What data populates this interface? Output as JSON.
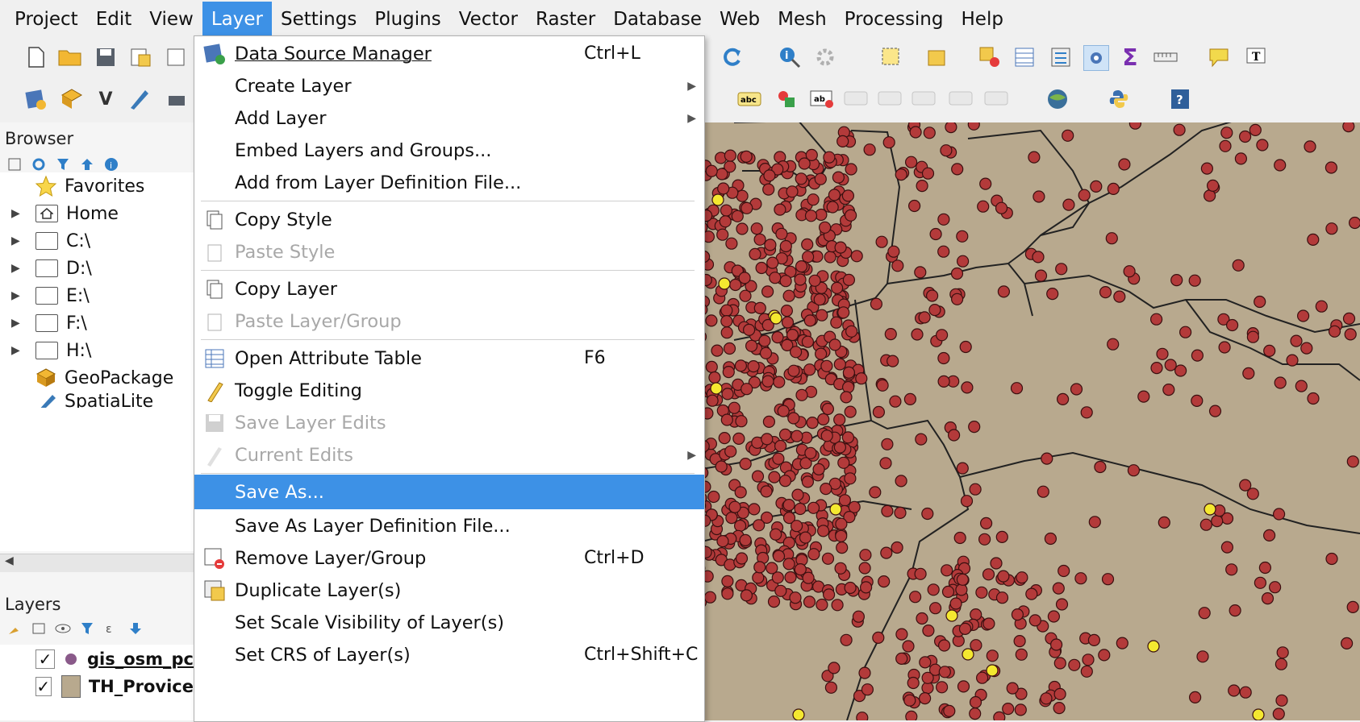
{
  "menubar": {
    "items": [
      "Project",
      "Edit",
      "View",
      "Layer",
      "Settings",
      "Plugins",
      "Vector",
      "Raster",
      "Database",
      "Web",
      "Mesh",
      "Processing",
      "Help"
    ]
  },
  "browser": {
    "title": "Browser",
    "items": [
      {
        "label": "Favorites",
        "icon": "star-icon"
      },
      {
        "label": "Home",
        "icon": "home-icon"
      },
      {
        "label": "C:\\",
        "icon": "folder-icon"
      },
      {
        "label": "D:\\",
        "icon": "folder-icon"
      },
      {
        "label": "E:\\",
        "icon": "folder-icon"
      },
      {
        "label": "F:\\",
        "icon": "folder-icon"
      },
      {
        "label": "H:\\",
        "icon": "folder-icon"
      },
      {
        "label": "GeoPackage",
        "icon": "geopackage-icon"
      },
      {
        "label": "SpatiaLite",
        "icon": "spatialite-icon"
      }
    ]
  },
  "layers": {
    "title": "Layers",
    "items": [
      {
        "label": "gis_osm_pc",
        "checked": "✓"
      },
      {
        "label": "TH_Provice",
        "checked": "✓"
      }
    ]
  },
  "layer_menu": {
    "items": [
      {
        "label": "Data Source Manager",
        "shortcut": "Ctrl+L",
        "icon": "data-source-manager-icon"
      },
      {
        "label": "Create Layer",
        "submenu": "▶"
      },
      {
        "label": "Add Layer",
        "submenu": "▶"
      },
      {
        "label": "Embed Layers and Groups..."
      },
      {
        "label": "Add from Layer Definition File..."
      },
      {
        "label": "Copy Style",
        "icon": "copy-icon"
      },
      {
        "label": "Paste Style",
        "icon": "paste-icon",
        "disabled": true
      },
      {
        "label": "Copy Layer",
        "icon": "copy-icon"
      },
      {
        "label": "Paste Layer/Group",
        "icon": "paste-icon",
        "disabled": true
      },
      {
        "label": "Open Attribute Table",
        "shortcut": "F6",
        "icon": "attribute-table-icon"
      },
      {
        "label": "Toggle Editing",
        "icon": "pencil-icon"
      },
      {
        "label": "Save Layer Edits",
        "icon": "save-edits-icon",
        "disabled": true
      },
      {
        "label": "Current Edits",
        "icon": "current-edits-icon",
        "disabled": true,
        "submenu": "▶"
      },
      {
        "label": "Save As...",
        "highlighted": true
      },
      {
        "label": "Save As Layer Definition File..."
      },
      {
        "label": "Remove Layer/Group",
        "shortcut": "Ctrl+D",
        "icon": "remove-layer-icon"
      },
      {
        "label": "Duplicate Layer(s)",
        "icon": "duplicate-layer-icon"
      },
      {
        "label": "Set Scale Visibility of Layer(s)"
      },
      {
        "label": "Set CRS of Layer(s)",
        "shortcut": "Ctrl+Shift+C"
      }
    ]
  },
  "colors": {
    "map_bg": "#b8a98e",
    "point_fill": "#b33a3a",
    "point_highlight": "#f4e830",
    "menu_highlight": "#3d91e6"
  }
}
